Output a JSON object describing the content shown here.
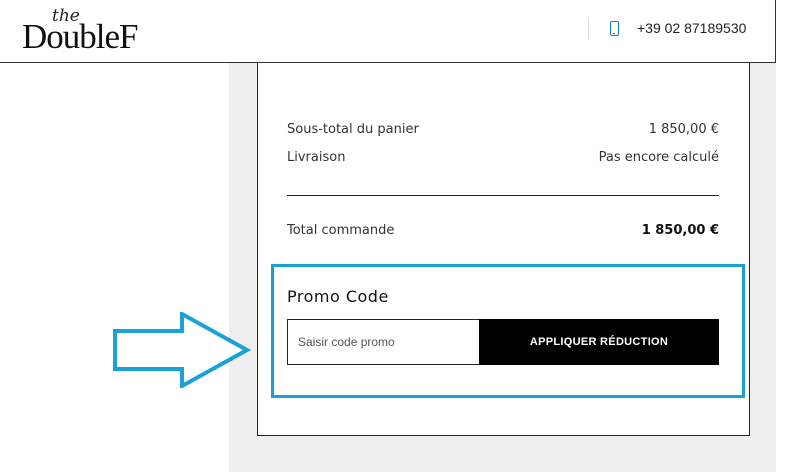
{
  "header": {
    "logo_prefix": "the",
    "logo_main": "DoubleF",
    "phone_icon": "phone-icon",
    "phone_number": "+39 02 87189530"
  },
  "summary": {
    "subtotal_label": "Sous-total du panier",
    "subtotal_value": "1 850,00 €",
    "shipping_label": "Livraison",
    "shipping_value": "Pas encore calculé",
    "total_label": "Total commande",
    "total_value": "1 850,00 €"
  },
  "promo": {
    "title": "Promo Code",
    "input_placeholder": "Saisir code promo",
    "input_value": "",
    "button_label": "APPLIQUER RÉDUCTION"
  },
  "annotation": {
    "highlight_color": "#1aa1d8",
    "arrow_icon": "right-arrow-icon"
  }
}
